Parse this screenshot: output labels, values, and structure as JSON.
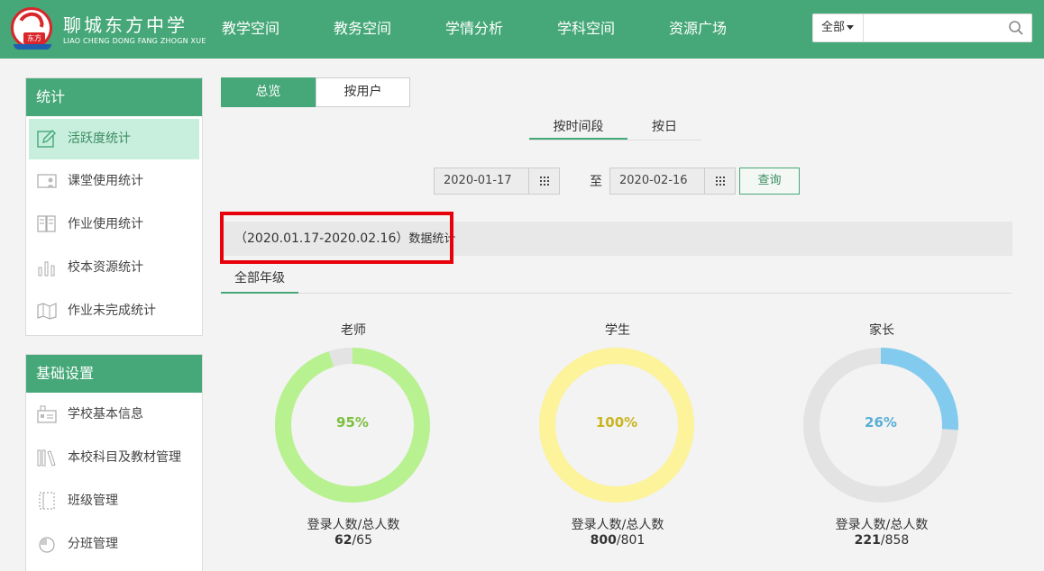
{
  "header": {
    "school_name": "聊城东方中学",
    "school_name_en": "LIAO CHENG DONG FANG ZHOGN XUE",
    "logo_tag": "东方",
    "nav": [
      "教学空间",
      "教务空间",
      "学情分析",
      "学科空间",
      "资源广场"
    ],
    "search": {
      "scope": "全部",
      "placeholder": ""
    }
  },
  "sidebar": {
    "stats_title": "统计",
    "stats_items": [
      {
        "label": "活跃度统计",
        "icon": "pencil-icon",
        "active": true
      },
      {
        "label": "课堂使用统计",
        "icon": "classroom-icon"
      },
      {
        "label": "作业使用统计",
        "icon": "homework-icon"
      },
      {
        "label": "校本资源统计",
        "icon": "bar-chart-icon"
      },
      {
        "label": "作业未完成统计",
        "icon": "map-icon"
      }
    ],
    "settings_title": "基础设置",
    "settings_items": [
      {
        "label": "学校基本信息",
        "icon": "school-info-icon"
      },
      {
        "label": "本校科目及教材管理",
        "icon": "books-icon"
      },
      {
        "label": "班级管理",
        "icon": "class-icon"
      },
      {
        "label": "分班管理",
        "icon": "pie-icon"
      }
    ]
  },
  "main": {
    "tabs": [
      "总览",
      "按用户"
    ],
    "subtabs": [
      "按时间段",
      "按日"
    ],
    "date_from": "2020-01-17",
    "date_to": "2020-02-16",
    "date_sep": "至",
    "query_label": "查询",
    "stat_range": "（2020.01.17-2020.02.16）",
    "stat_suffix": "数据统计",
    "grade_tab": "全部年级"
  },
  "chart_data": {
    "type": "pie",
    "series": [
      {
        "name": "老师",
        "percent": "95%",
        "fraction": 0.95,
        "caption": "登录人数/总人数",
        "logged": "62",
        "total_text": "/65",
        "color": "#b8f18f",
        "text_color": "#7bbf3f"
      },
      {
        "name": "学生",
        "percent": "100%",
        "fraction": 1.0,
        "caption": "登录人数/总人数",
        "logged": "800",
        "total_text": "/801",
        "color": "#fdf39a",
        "text_color": "#c9b520"
      },
      {
        "name": "家长",
        "percent": "26%",
        "fraction": 0.26,
        "caption": "登录人数/总人数",
        "logged": "221",
        "total_text": "/858",
        "color": "#82cbef",
        "text_color": "#5aaed6"
      }
    ],
    "track_color": "#e3e3e3"
  }
}
